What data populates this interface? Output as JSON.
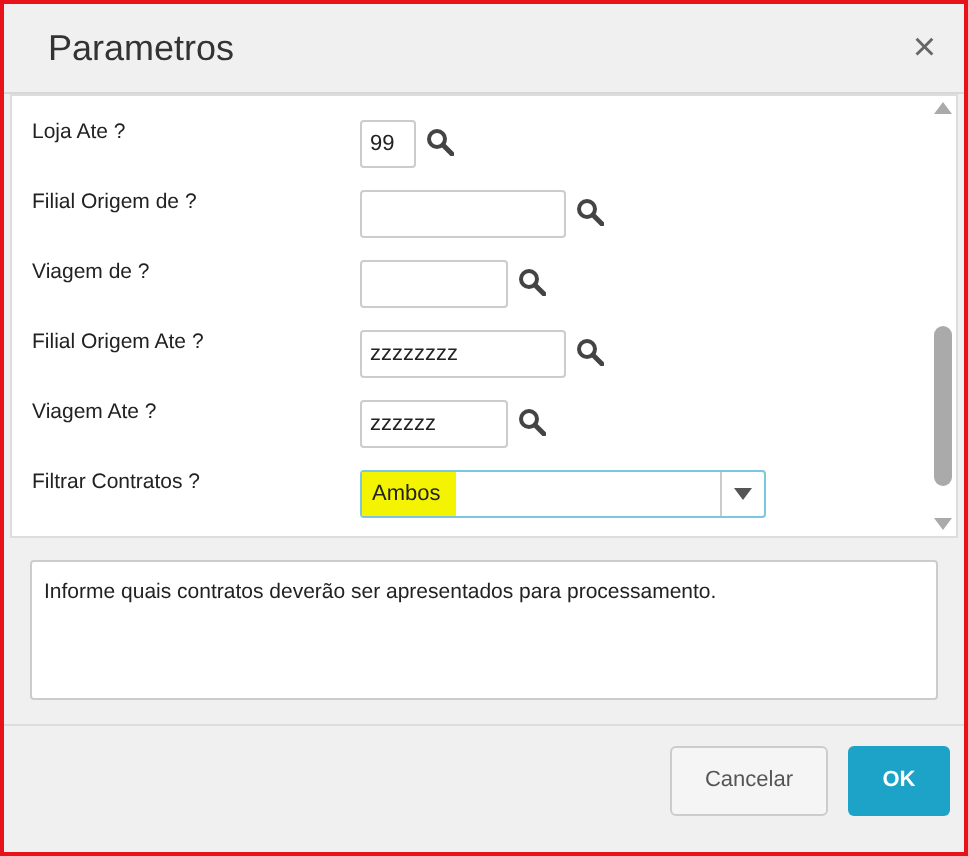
{
  "dialog": {
    "title": "Parametros",
    "close": "×"
  },
  "fields": [
    {
      "kind": "lookup",
      "label": "Loja Ate ?",
      "value": "99"
    },
    {
      "kind": "lookup",
      "label": "Filial Origem de ?"
    },
    {
      "kind": "lookup",
      "label": "Viagem de ?"
    },
    {
      "kind": "lookup",
      "label": "Filial Origem Ate ?",
      "value": "zzzzzzzz"
    },
    {
      "kind": "lookup",
      "label": "Viagem Ate ?",
      "value": "zzzzzz"
    },
    {
      "kind": "select",
      "label": "Filtrar Contratos ?",
      "value": "Ambos",
      "highlighted": true
    }
  ],
  "help_text": "Informe quais contratos deverão ser apresentados para processamento.",
  "buttons": [
    {
      "label": "Cancelar",
      "primary": false
    },
    {
      "label": "OK",
      "primary": true
    }
  ]
}
